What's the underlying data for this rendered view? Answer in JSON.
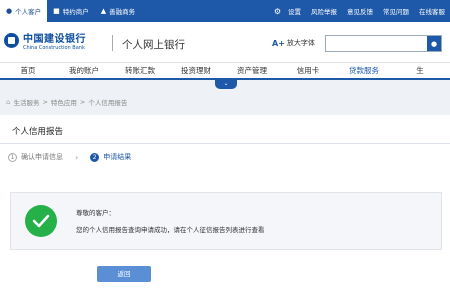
{
  "topbar": {
    "left": [
      {
        "icon": "user-icon",
        "label": "个人客户",
        "active": true
      },
      {
        "icon": "building-icon",
        "label": "特约商户",
        "active": false
      },
      {
        "icon": "cart-icon",
        "label": "善融商务",
        "active": false
      }
    ],
    "right": [
      "设置",
      "风险举报",
      "意见反馈",
      "常见问题",
      "在线客服"
    ]
  },
  "header": {
    "bank_cn": "中国建设银行",
    "bank_en": "China Construction Bank",
    "site_title": "个人网上银行",
    "font_size_btn": "放大字体",
    "search_placeholder": ""
  },
  "nav": [
    "首页",
    "我的账户",
    "转账汇款",
    "投资理财",
    "资产管理",
    "信用卡",
    "贷款服务",
    "生"
  ],
  "breadcrumb": [
    "生活服务",
    "特色应用",
    "个人信用报告"
  ],
  "page": {
    "title": "个人信用报告",
    "steps": [
      {
        "num": "1",
        "label": "确认申请信息"
      },
      {
        "num": "2",
        "label": "申请结果"
      }
    ],
    "notice_title": "尊敬的客户：",
    "notice_body": "您的个人信用报告查询申请成功，请在个人征信报告列表进行查看",
    "back_label": "返回"
  },
  "colors": {
    "brand": "#1e58a8",
    "success": "#25b04a",
    "button": "#5a8fd6"
  }
}
